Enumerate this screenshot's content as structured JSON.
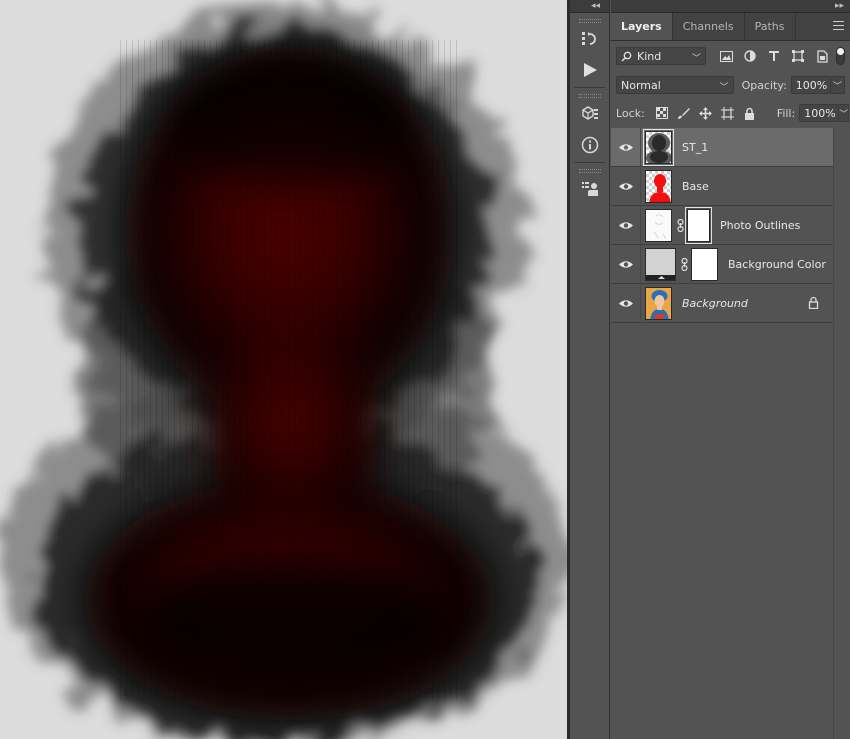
{
  "tabs": [
    {
      "label": "Layers",
      "active": true
    },
    {
      "label": "Channels",
      "active": false
    },
    {
      "label": "Paths",
      "active": false
    }
  ],
  "filter": {
    "kind_label": "Kind"
  },
  "blend": {
    "mode": "Normal",
    "opacity_label": "Opacity:",
    "opacity_value": "100%"
  },
  "lock": {
    "label": "Lock:",
    "fill_label": "Fill:",
    "fill_value": "100%"
  },
  "layers": [
    {
      "name": "ST_1",
      "selected": true,
      "thumb": "texture-thumbnail"
    },
    {
      "name": "Base",
      "selected": false,
      "thumb": "red-silhouette-thumbnail"
    },
    {
      "name": "Photo Outlines",
      "selected": false,
      "thumb": "outline-thumbnail",
      "has_mask": true
    },
    {
      "name": "Background Color",
      "selected": false,
      "thumb": "fill-thumbnail",
      "has_mask": true
    },
    {
      "name": "Background",
      "selected": false,
      "thumb": "photo-thumbnail",
      "locked": true
    }
  ],
  "tools": [
    "history-icon",
    "play-icon",
    "3d-cube-icon",
    "info-icon",
    "layer-comps-icon"
  ],
  "colors": {
    "panel": "#535353",
    "tabbar": "#424242",
    "selected_row": "#6b6b6b",
    "canvas_bg": "#dcdcdc",
    "red": "#8a0a0a"
  }
}
